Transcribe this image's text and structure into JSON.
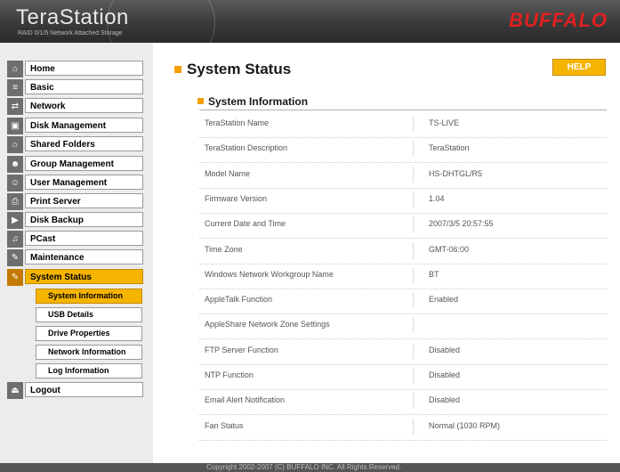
{
  "header": {
    "logo": "TeraStation",
    "tagline": "RAID 0/1/5 Network Attached Storage",
    "brand": "BUFFALO"
  },
  "sidebar": {
    "items": [
      {
        "label": "Home",
        "icon": "home-icon"
      },
      {
        "label": "Basic",
        "icon": "basic-settings-icon"
      },
      {
        "label": "Network",
        "icon": "network-icon"
      },
      {
        "label": "Disk Management",
        "icon": "disk-icon"
      },
      {
        "label": "Shared Folders",
        "icon": "shared-folder-icon"
      },
      {
        "label": "Group Management",
        "icon": "group-icon"
      },
      {
        "label": "User Management",
        "icon": "user-icon"
      },
      {
        "label": "Print Server",
        "icon": "printer-icon"
      },
      {
        "label": "Disk Backup",
        "icon": "backup-icon"
      },
      {
        "label": "PCast",
        "icon": "pcast-icon"
      },
      {
        "label": "Maintenance",
        "icon": "maintenance-icon"
      },
      {
        "label": "System Status",
        "icon": "system-status-icon"
      }
    ],
    "subitems": [
      {
        "label": "System Information"
      },
      {
        "label": "USB Details"
      },
      {
        "label": "Drive Properties"
      },
      {
        "label": "Network Information"
      },
      {
        "label": "Log Information"
      }
    ],
    "logout": {
      "label": "Logout",
      "icon": "logout-icon"
    }
  },
  "main": {
    "title": "System Status",
    "help_label": "HELP",
    "section_title": "System Information",
    "rows": [
      {
        "label": "TeraStation Name",
        "value": "TS-LIVE"
      },
      {
        "label": "TeraStation Description",
        "value": "TeraStation"
      },
      {
        "label": "Model Name",
        "value": "HS-DHTGL/R5"
      },
      {
        "label": "Firmware Version",
        "value": "1.04"
      },
      {
        "label": "Current Date and Time",
        "value": "2007/3/5 20:57:55"
      },
      {
        "label": "Time Zone",
        "value": "GMT-06:00"
      },
      {
        "label": "Windows Network Workgroup Name",
        "value": "BT"
      },
      {
        "label": "AppleTalk Function",
        "value": "Enabled"
      },
      {
        "label": "AppleShare Network Zone Settings",
        "value": ""
      },
      {
        "label": "FTP Server Function",
        "value": "Disabled"
      },
      {
        "label": "NTP Function",
        "value": "Disabled"
      },
      {
        "label": "Email Alert Notification",
        "value": "Disabled"
      },
      {
        "label": "Fan Status",
        "value": "Normal (1030 RPM)"
      }
    ]
  },
  "footer": {
    "copyright": "Copyright 2002-2007 (C) BUFFALO INC. All Rights Reserved."
  },
  "colors": {
    "accent": "#f5b400",
    "brand": "#e02020",
    "header_bg": "#3a3a3a"
  }
}
